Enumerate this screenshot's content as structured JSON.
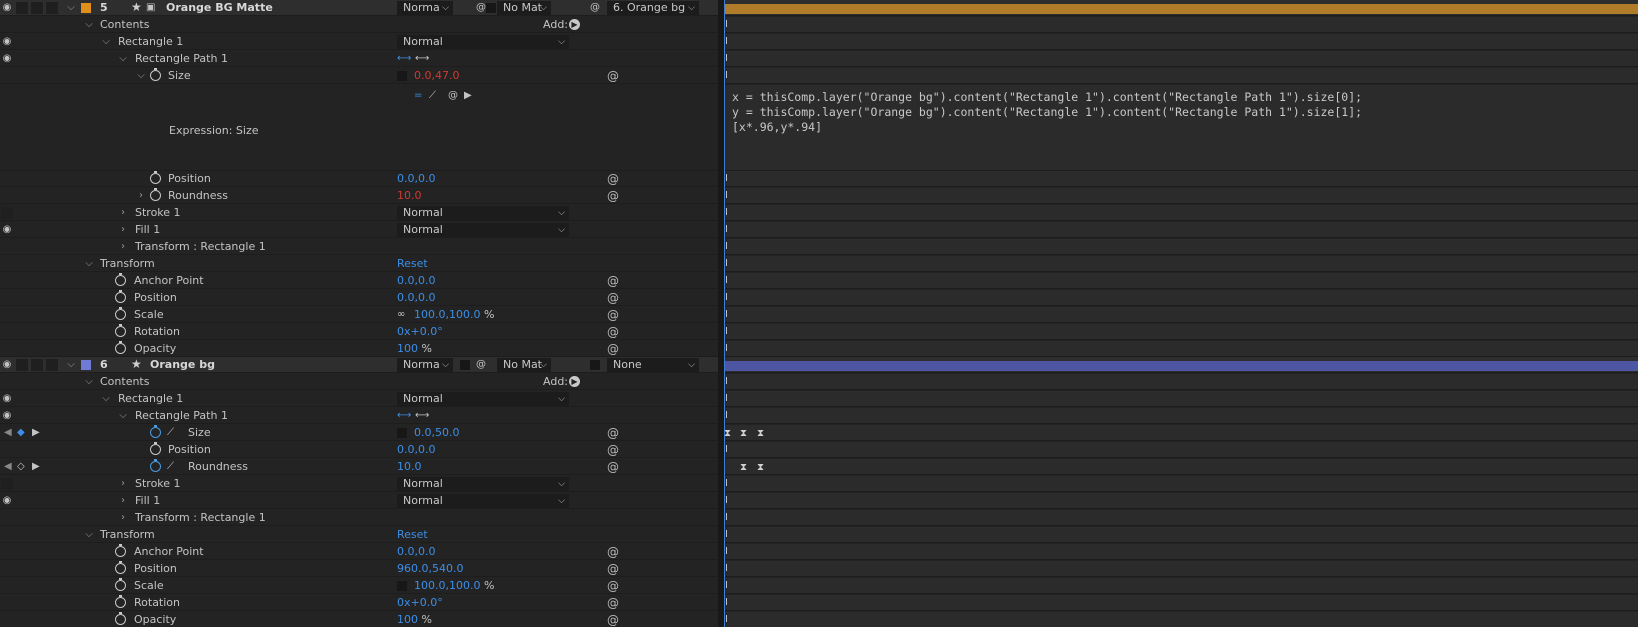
{
  "layers": [
    {
      "number": "5",
      "name": "Orange BG Matte",
      "label_color": "#e0901a",
      "mode": "Norma",
      "track_matte": "No Mat",
      "parent": "6. Orange bg",
      "bar_color": "#b07c2a"
    },
    {
      "number": "6",
      "name": "Orange bg",
      "label_color": "#6f7bd6",
      "mode": "Norma",
      "track_matte": "No Mat",
      "parent": "None",
      "bar_color": "#4e56a3"
    }
  ],
  "labels": {
    "contents": "Contents",
    "add": "Add:",
    "rectangle": "Rectangle 1",
    "rect_path": "Rectangle Path 1",
    "size": "Size",
    "position": "Position",
    "roundness": "Roundness",
    "stroke": "Stroke 1",
    "fill": "Fill 1",
    "transform_rect": "Transform : Rectangle 1",
    "transform": "Transform",
    "reset": "Reset",
    "anchor": "Anchor Point",
    "scale": "Scale",
    "rotation": "Rotation",
    "opacity": "Opacity",
    "blend_normal": "Normal",
    "expression_label": "Expression: Size",
    "percent": "%"
  },
  "layer5_values": {
    "size": "0.0,47.0",
    "position": "0.0,0.0",
    "roundness": "10.0",
    "anchor": "0.0,0.0",
    "tposition": "0.0,0.0",
    "scale": "100.0,100.0",
    "rotation": "0x+0.0°",
    "opacity": "100"
  },
  "layer6_values": {
    "size": "0.0,50.0",
    "position": "0.0,0.0",
    "roundness": "10.0",
    "anchor": "0.0,0.0",
    "tposition": "960.0,540.0",
    "scale": "100.0,100.0",
    "rotation": "0x+0.0°",
    "opacity": "100"
  },
  "expression": {
    "line1": "x = thisComp.layer(\"Orange bg\").content(\"Rectangle 1\").content(\"Rectangle Path 1\").size[0];",
    "line2": "y = thisComp.layer(\"Orange bg\").content(\"Rectangle 1\").content(\"Rectangle Path 1\").size[1];",
    "line3": "",
    "line4": "[x*.96,y*.94]"
  }
}
